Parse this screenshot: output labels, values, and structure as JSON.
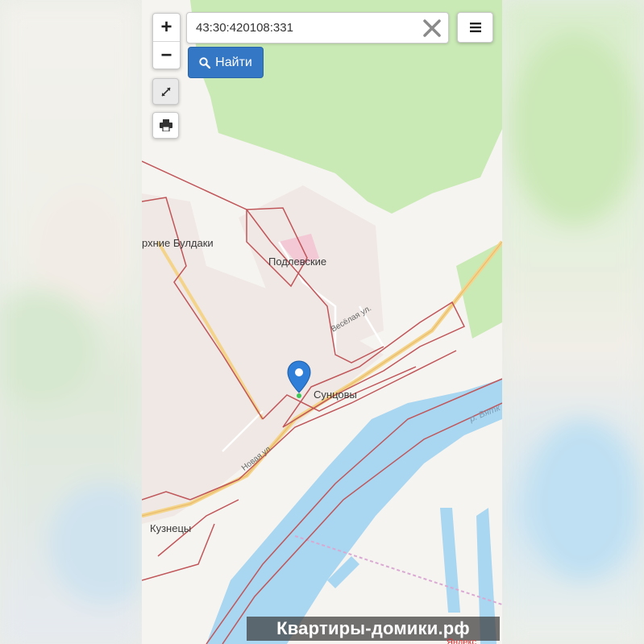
{
  "search": {
    "value": "43:30:420108:331"
  },
  "buttons": {
    "zoom_in": "+",
    "zoom_out": "−",
    "menu": "≡",
    "find_label": "Найти"
  },
  "icons": {
    "zoom_in": "plus-icon",
    "zoom_out": "minus-icon",
    "clear": "close-icon",
    "menu": "hamburger-menu-icon",
    "find": "search-icon",
    "fullscreen": "fullscreen-icon",
    "print": "printer-icon",
    "marker": "map-pin-icon"
  },
  "places": {
    "verkhnie_buldaki": "рхние Булдаки",
    "podlevskie": "Подлевские",
    "suntsovy": "Сунцовы",
    "kuznetsy": "Кузнецы"
  },
  "streets": {
    "veselaya": "Весёлая ул.",
    "novaya": "Новая ул."
  },
  "river": "р. Вятк",
  "watermark": "Квартиры-домики.рф",
  "attribution": "Яндекс",
  "colors": {
    "forest": "#c9e9b5",
    "water": "#a9d6f0",
    "boundary": "#c0565a",
    "road": "#f4d48a",
    "button_primary": "#3477c4",
    "marker": "#2f7fd8"
  }
}
